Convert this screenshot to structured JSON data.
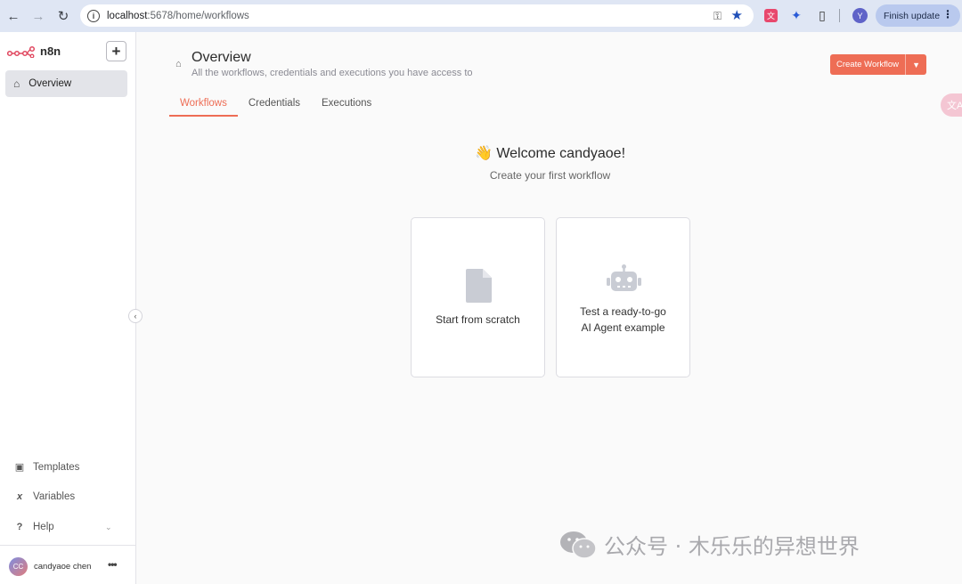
{
  "browser": {
    "url_host": "localhost",
    "url_path": ":5678/home/workflows",
    "profile_initial": "Y",
    "finish_update_label": "Finish update"
  },
  "sidebar": {
    "brand": "n8n",
    "add_label": "+",
    "overview_label": "Overview",
    "bottom_items": [
      {
        "label": "Templates",
        "icon": "box-icon"
      },
      {
        "label": "Variables",
        "icon": "variable-icon"
      },
      {
        "label": "Help",
        "icon": "question-icon"
      }
    ],
    "user": {
      "initials": "CC",
      "name": "candyaoe chen"
    }
  },
  "header": {
    "title": "Overview",
    "subtitle": "All the workflows, credentials and executions you have access to",
    "create_label": "Create Workflow"
  },
  "tabs": [
    {
      "label": "Workflows",
      "active": true
    },
    {
      "label": "Credentials",
      "active": false
    },
    {
      "label": "Executions",
      "active": false
    }
  ],
  "welcome": {
    "title": "👋 Welcome candyaoe!",
    "subtitle": "Create your first workflow"
  },
  "cards": [
    {
      "label_line1": "Start from scratch",
      "icon": "document-icon"
    },
    {
      "label_line1": "Test a ready-to-go",
      "label_line2": "AI Agent example",
      "icon": "robot-icon"
    }
  ],
  "watermark": "公众号 · 木乐乐的异想世界",
  "colors": {
    "accent": "#ee6d55",
    "chrome": "#dfe6f4"
  }
}
